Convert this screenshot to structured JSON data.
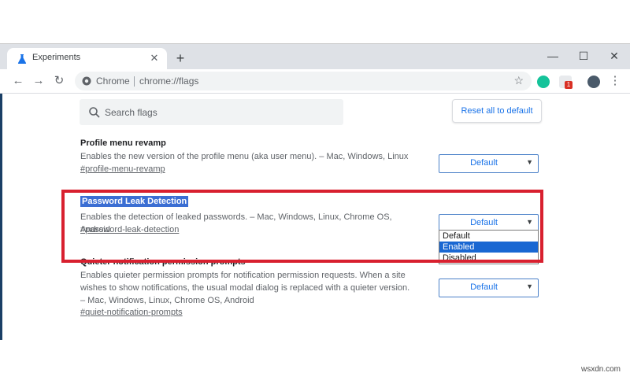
{
  "tab": {
    "title": "Experiments",
    "close_glyph": "✕"
  },
  "window": {
    "minimize": "—",
    "maximize": "☐",
    "close": "✕",
    "newtab": "+"
  },
  "toolbar": {
    "back": "←",
    "forward": "→",
    "reload": "↻",
    "origin": "Chrome",
    "url": "chrome://flags",
    "star": "☆",
    "ext_badge": "1"
  },
  "search": {
    "placeholder": "Search flags"
  },
  "reset_label": "Reset all to default",
  "flags": [
    {
      "title": "Profile menu revamp",
      "desc": "Enables the new version of the profile menu (aka user menu). – Mac, Windows, Linux",
      "link": "#profile-menu-revamp",
      "value": "Default"
    },
    {
      "title": "Password Leak Detection",
      "desc": "Enables the detection of leaked passwords. – Mac, Windows, Linux, Chrome OS, Android",
      "link": "#password-leak-detection",
      "value": "Default",
      "options": [
        "Default",
        "Enabled",
        "Disabled"
      ],
      "highlighted_option": "Enabled"
    },
    {
      "title": "Quieter notification permission prompts",
      "desc": "Enables quieter permission prompts for notification permission requests. When a site wishes to show notifications, the usual modal dialog is replaced with a quieter version. – Mac, Windows, Linux, Chrome OS, Android",
      "link": "#quiet-notification-prompts",
      "value": "Default"
    }
  ],
  "select_arrow": "▼",
  "colors": {
    "accent": "#1a73e8",
    "annotation_box": "#d8202f",
    "tab_strip": "#dee1e6"
  },
  "watermark": "wsxdn.com"
}
